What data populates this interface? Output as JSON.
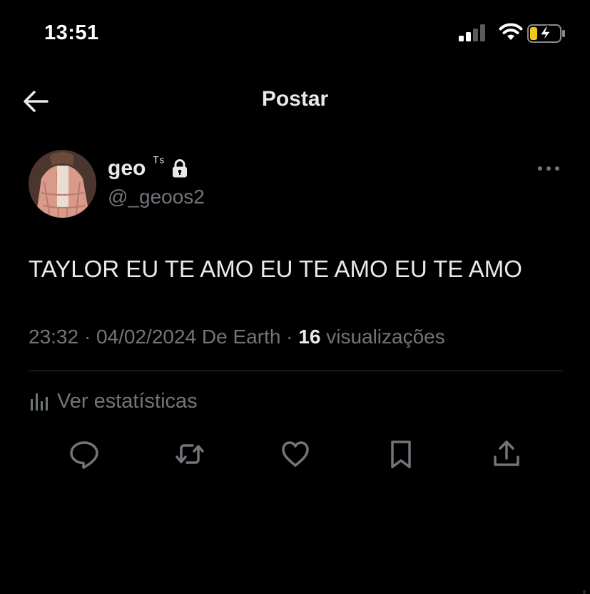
{
  "status_bar": {
    "time": "13:51",
    "icons": [
      "signal-icon",
      "wifi-icon",
      "battery-charging-icon"
    ],
    "battery_color": "#f5c518"
  },
  "header": {
    "title": "Postar",
    "back_icon": "back-arrow-icon"
  },
  "post": {
    "author": {
      "display_name": "geo",
      "name_suffix": "ᵀˢ",
      "handle": "@_geoos2",
      "locked": true
    },
    "text": "TAYLOR EU TE AMO EU TE AMO EU TE AMO",
    "meta": {
      "time": "23:32",
      "sep1": " · ",
      "date": "04/02/2024",
      "source": " De Earth",
      "sep2": " · ",
      "views_count": "16",
      "views_label": " visualizações"
    },
    "stats_label": "Ver estatísticas",
    "actions": [
      "reply-icon",
      "repost-icon",
      "like-icon",
      "bookmark-icon",
      "share-icon"
    ]
  },
  "colors": {
    "background": "#000000",
    "primary_text": "#e7e9ea",
    "secondary_text": "#71767b",
    "divider": "#2f3336"
  }
}
